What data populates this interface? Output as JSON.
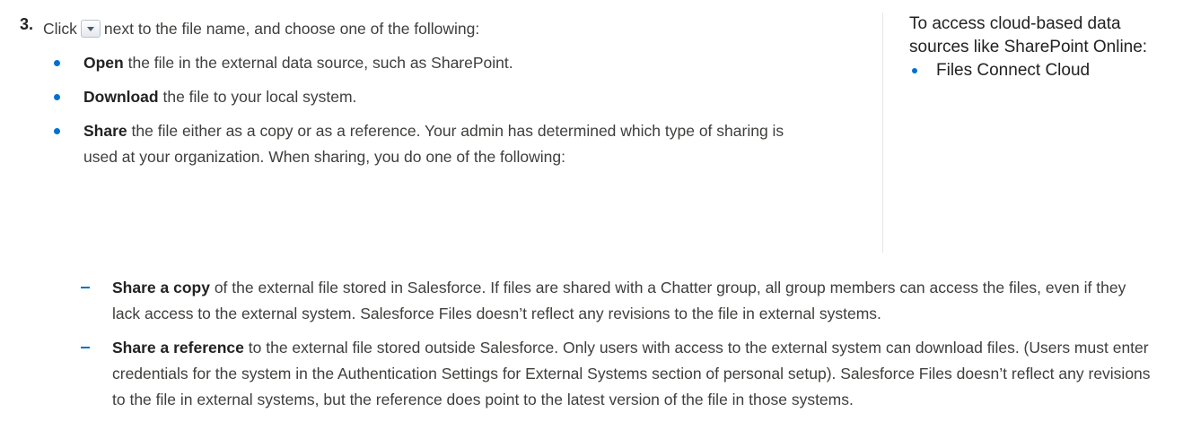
{
  "step": {
    "number": "3.",
    "intro_before": "Click",
    "intro_after": "next to the file name, and choose one of the following:"
  },
  "options": [
    {
      "bold": "Open",
      "rest": "the file in the external data source, such as SharePoint."
    },
    {
      "bold": "Download",
      "rest": "the file to your local system."
    },
    {
      "bold": "Share",
      "rest": "the file either as a copy or as a reference. Your admin has determined which type of sharing is used at your organization. When sharing, you do one of the following:"
    }
  ],
  "share_options": [
    {
      "bold": "Share a copy",
      "rest": "of the external file stored in Salesforce. If files are shared with a Chatter group, all group members can access the files, even if they lack access to the external system. Salesforce Files doesn’t reflect any revisions to the file in external systems."
    },
    {
      "bold": "Share a reference",
      "rest": "to the external file stored outside Salesforce. Only users with access to the external system can download files. (Users must enter credentials for the system in the Authentication Settings for External Systems section of personal setup). Salesforce Files doesn’t reflect any revisions to the file in external systems, but the reference does point to the latest version of the file in those systems."
    }
  ],
  "sidebar": {
    "heading": "To access cloud-based data sources like SharePoint Online:",
    "items": [
      "Files Connect Cloud"
    ]
  },
  "colors": {
    "accent": "#0070d2",
    "text": "#3e3e3c"
  },
  "icons": {
    "dropdown": "chevron-down-icon"
  }
}
